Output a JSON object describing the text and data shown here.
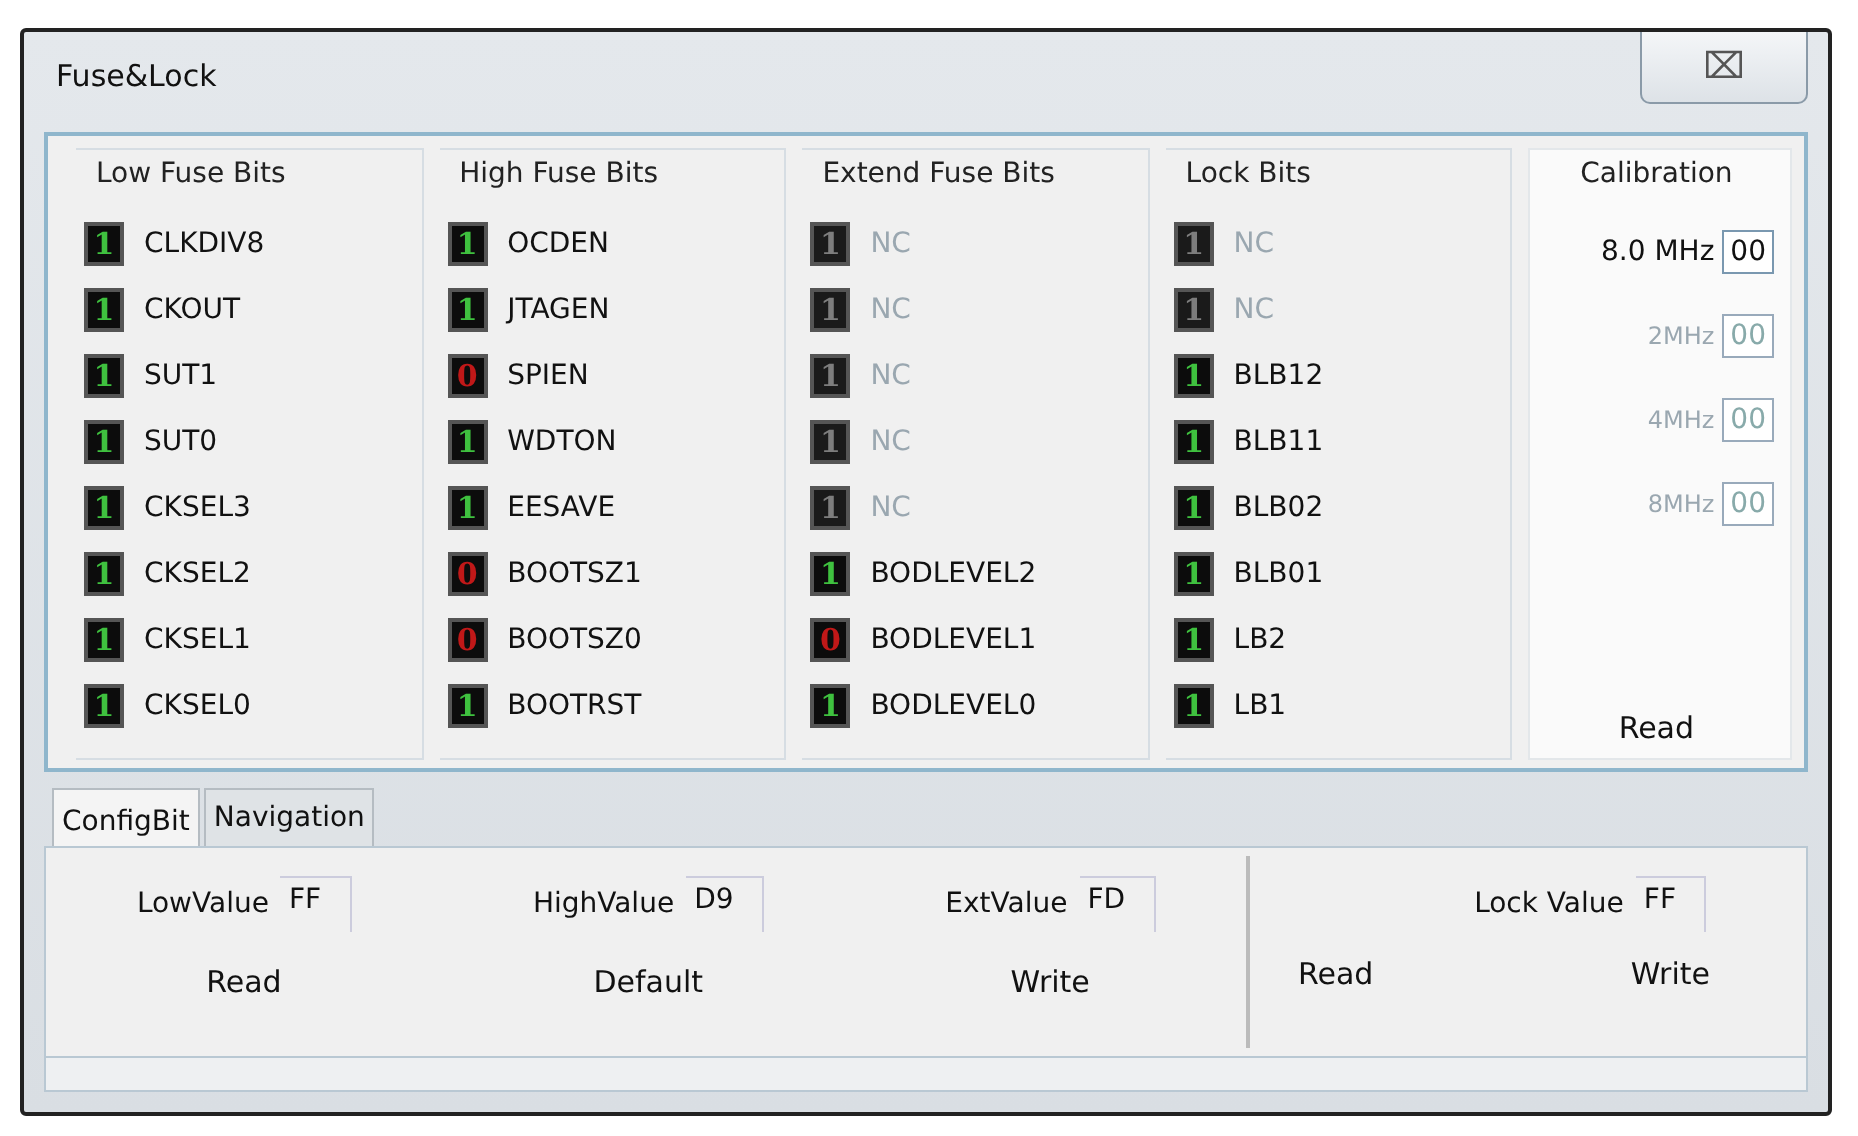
{
  "window": {
    "title": "Fuse&Lock",
    "close": "⌧"
  },
  "groups": [
    {
      "title": "Low Fuse Bits",
      "bits": [
        {
          "value": "1",
          "on": true,
          "disabled": false,
          "name": "CLKDIV8"
        },
        {
          "value": "1",
          "on": true,
          "disabled": false,
          "name": "CKOUT"
        },
        {
          "value": "1",
          "on": true,
          "disabled": false,
          "name": "SUT1"
        },
        {
          "value": "1",
          "on": true,
          "disabled": false,
          "name": "SUT0"
        },
        {
          "value": "1",
          "on": true,
          "disabled": false,
          "name": "CKSEL3"
        },
        {
          "value": "1",
          "on": true,
          "disabled": false,
          "name": "CKSEL2"
        },
        {
          "value": "1",
          "on": true,
          "disabled": false,
          "name": "CKSEL1"
        },
        {
          "value": "1",
          "on": true,
          "disabled": false,
          "name": "CKSEL0"
        }
      ]
    },
    {
      "title": "High Fuse Bits",
      "bits": [
        {
          "value": "1",
          "on": true,
          "disabled": false,
          "name": "OCDEN"
        },
        {
          "value": "1",
          "on": true,
          "disabled": false,
          "name": "JTAGEN"
        },
        {
          "value": "0",
          "on": false,
          "disabled": false,
          "name": "SPIEN"
        },
        {
          "value": "1",
          "on": true,
          "disabled": false,
          "name": "WDTON"
        },
        {
          "value": "1",
          "on": true,
          "disabled": false,
          "name": "EESAVE"
        },
        {
          "value": "0",
          "on": false,
          "disabled": false,
          "name": "BOOTSZ1"
        },
        {
          "value": "0",
          "on": false,
          "disabled": false,
          "name": "BOOTSZ0"
        },
        {
          "value": "1",
          "on": true,
          "disabled": false,
          "name": "BOOTRST"
        }
      ]
    },
    {
      "title": "Extend Fuse Bits",
      "bits": [
        {
          "value": "1",
          "on": true,
          "disabled": true,
          "name": "NC"
        },
        {
          "value": "1",
          "on": true,
          "disabled": true,
          "name": "NC"
        },
        {
          "value": "1",
          "on": true,
          "disabled": true,
          "name": "NC"
        },
        {
          "value": "1",
          "on": true,
          "disabled": true,
          "name": "NC"
        },
        {
          "value": "1",
          "on": true,
          "disabled": true,
          "name": "NC"
        },
        {
          "value": "1",
          "on": true,
          "disabled": false,
          "name": "BODLEVEL2"
        },
        {
          "value": "0",
          "on": false,
          "disabled": false,
          "name": "BODLEVEL1"
        },
        {
          "value": "1",
          "on": true,
          "disabled": false,
          "name": "BODLEVEL0"
        }
      ]
    },
    {
      "title": "Lock Bits",
      "bits": [
        {
          "value": "1",
          "on": true,
          "disabled": true,
          "name": "NC"
        },
        {
          "value": "1",
          "on": true,
          "disabled": true,
          "name": "NC"
        },
        {
          "value": "1",
          "on": true,
          "disabled": false,
          "name": "BLB12"
        },
        {
          "value": "1",
          "on": true,
          "disabled": false,
          "name": "BLB11"
        },
        {
          "value": "1",
          "on": true,
          "disabled": false,
          "name": "BLB02"
        },
        {
          "value": "1",
          "on": true,
          "disabled": false,
          "name": "BLB01"
        },
        {
          "value": "1",
          "on": true,
          "disabled": false,
          "name": "LB2"
        },
        {
          "value": "1",
          "on": true,
          "disabled": false,
          "name": "LB1"
        }
      ]
    }
  ],
  "calibration": {
    "title": "Calibration",
    "rows": [
      {
        "label": "8.0 MHz",
        "value": "00",
        "disabled": false
      },
      {
        "label": "2MHz",
        "value": "00",
        "disabled": true
      },
      {
        "label": "4MHz",
        "value": "00",
        "disabled": true
      },
      {
        "label": "8MHz",
        "value": "00",
        "disabled": true
      }
    ],
    "button": "Read"
  },
  "tabs": [
    {
      "label": "ConfigBit",
      "selected": true
    },
    {
      "label": "Navigation",
      "selected": false
    }
  ],
  "fuse_values": [
    {
      "label": "LowValue",
      "value": "FF",
      "button": "Read"
    },
    {
      "label": "HighValue",
      "value": "D9",
      "button": "Default"
    },
    {
      "label": "ExtValue",
      "value": "FD",
      "button": "Write"
    }
  ],
  "lock_value": {
    "label": "Lock Value",
    "value": "FF",
    "buttons": [
      "Read",
      "Write"
    ]
  }
}
